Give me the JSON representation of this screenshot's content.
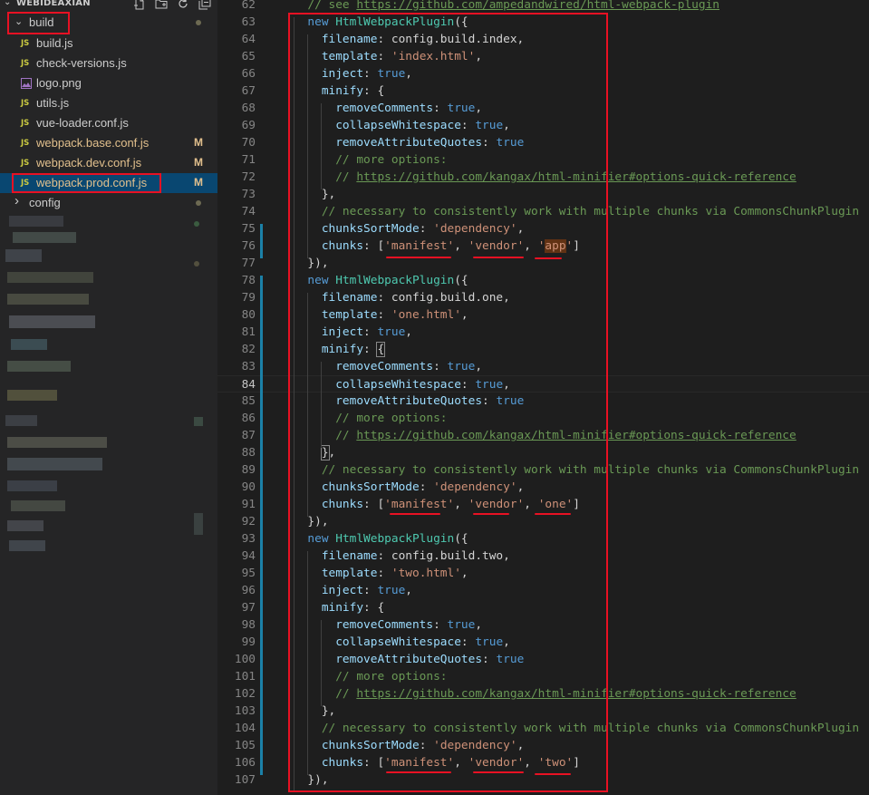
{
  "explorer": {
    "title": "WEBIDEAXIAN",
    "actions": [
      "new-file-icon",
      "new-folder-icon",
      "refresh-icon",
      "collapse-all-icon"
    ],
    "items": [
      {
        "label": "build",
        "kind": "folder-open",
        "status": "dot"
      },
      {
        "label": "build.js",
        "kind": "js",
        "status": ""
      },
      {
        "label": "check-versions.js",
        "kind": "js",
        "status": ""
      },
      {
        "label": "logo.png",
        "kind": "image",
        "status": ""
      },
      {
        "label": "utils.js",
        "kind": "js",
        "status": ""
      },
      {
        "label": "vue-loader.conf.js",
        "kind": "js",
        "status": ""
      },
      {
        "label": "webpack.base.conf.js",
        "kind": "js",
        "status": "M"
      },
      {
        "label": "webpack.dev.conf.js",
        "kind": "js",
        "status": "M"
      },
      {
        "label": "webpack.prod.conf.js",
        "kind": "js",
        "status": "M",
        "selected": true
      },
      {
        "label": "config",
        "kind": "folder-closed",
        "status": "dot"
      }
    ],
    "js_badge": "JS"
  },
  "editor": {
    "active_line": 84,
    "lines": [
      {
        "n": 62,
        "tokens": [
          [
            "c",
            "  // see "
          ],
          [
            "cu",
            "https://github.com/ampedandwired/html-webpack-plugin"
          ]
        ]
      },
      {
        "n": 63,
        "tokens": [
          [
            "k",
            "  new "
          ],
          [
            "cls",
            "HtmlWebpackPlugin"
          ],
          [
            "d",
            "({"
          ]
        ]
      },
      {
        "n": 64,
        "tokens": [
          [
            "p",
            "    filename"
          ],
          [
            "d",
            ": config.build.index,"
          ]
        ]
      },
      {
        "n": 65,
        "tokens": [
          [
            "p",
            "    template"
          ],
          [
            "d",
            ": "
          ],
          [
            "s",
            "'index.html'"
          ],
          [
            "d",
            ","
          ]
        ]
      },
      {
        "n": 66,
        "tokens": [
          [
            "p",
            "    inject"
          ],
          [
            "d",
            ": "
          ],
          [
            "k",
            "true"
          ],
          [
            "d",
            ","
          ]
        ]
      },
      {
        "n": 67,
        "tokens": [
          [
            "p",
            "    minify"
          ],
          [
            "d",
            ": {"
          ]
        ]
      },
      {
        "n": 68,
        "tokens": [
          [
            "p",
            "      removeComments"
          ],
          [
            "d",
            ": "
          ],
          [
            "k",
            "true"
          ],
          [
            "d",
            ","
          ]
        ]
      },
      {
        "n": 69,
        "tokens": [
          [
            "p",
            "      collapseWhitespace"
          ],
          [
            "d",
            ": "
          ],
          [
            "k",
            "true"
          ],
          [
            "d",
            ","
          ]
        ]
      },
      {
        "n": 70,
        "tokens": [
          [
            "p",
            "      removeAttributeQuotes"
          ],
          [
            "d",
            ": "
          ],
          [
            "k",
            "true"
          ]
        ]
      },
      {
        "n": 71,
        "tokens": [
          [
            "c",
            "      // more options:"
          ]
        ]
      },
      {
        "n": 72,
        "tokens": [
          [
            "c",
            "      // "
          ],
          [
            "cu",
            "https://github.com/kangax/html-minifier#options-quick-reference"
          ]
        ]
      },
      {
        "n": 73,
        "tokens": [
          [
            "d",
            "    },"
          ]
        ]
      },
      {
        "n": 74,
        "tokens": [
          [
            "c",
            "    // necessary to consistently work with multiple chunks via CommonsChunkPlugin"
          ]
        ]
      },
      {
        "n": 75,
        "tokens": [
          [
            "p",
            "    chunksSortMode"
          ],
          [
            "d",
            ": "
          ],
          [
            "s",
            "'dependency'"
          ],
          [
            "d",
            ","
          ]
        ]
      },
      {
        "n": 76,
        "tokens": [
          [
            "p",
            "    chunks"
          ],
          [
            "d",
            ": ["
          ],
          [
            "s",
            "'manifest'"
          ],
          [
            "d",
            ", "
          ],
          [
            "s",
            "'vendor'"
          ],
          [
            "d",
            ", "
          ],
          [
            "shl",
            "'app'"
          ],
          [
            "d",
            "]"
          ]
        ]
      },
      {
        "n": 77,
        "tokens": [
          [
            "d",
            "  }),"
          ]
        ]
      },
      {
        "n": 78,
        "tokens": [
          [
            "k",
            "  new "
          ],
          [
            "cls",
            "HtmlWebpackPlugin"
          ],
          [
            "d",
            "({"
          ]
        ]
      },
      {
        "n": 79,
        "tokens": [
          [
            "p",
            "    filename"
          ],
          [
            "d",
            ": config.build.one,"
          ]
        ]
      },
      {
        "n": 80,
        "tokens": [
          [
            "p",
            "    template"
          ],
          [
            "d",
            ": "
          ],
          [
            "s",
            "'one.html'"
          ],
          [
            "d",
            ","
          ]
        ]
      },
      {
        "n": 81,
        "tokens": [
          [
            "p",
            "    inject"
          ],
          [
            "d",
            ": "
          ],
          [
            "k",
            "true"
          ],
          [
            "d",
            ","
          ]
        ]
      },
      {
        "n": 82,
        "tokens": [
          [
            "p",
            "    minify"
          ],
          [
            "d",
            ": "
          ],
          [
            "dbr",
            "{"
          ]
        ]
      },
      {
        "n": 83,
        "tokens": [
          [
            "p",
            "      removeComments"
          ],
          [
            "d",
            ": "
          ],
          [
            "k",
            "true"
          ],
          [
            "d",
            ","
          ]
        ]
      },
      {
        "n": 84,
        "tokens": [
          [
            "p",
            "      collapseWhitespace"
          ],
          [
            "d",
            ": "
          ],
          [
            "k",
            "true"
          ],
          [
            "d",
            ","
          ]
        ]
      },
      {
        "n": 85,
        "tokens": [
          [
            "p",
            "      removeAttributeQuotes"
          ],
          [
            "d",
            ": "
          ],
          [
            "k",
            "true"
          ]
        ]
      },
      {
        "n": 86,
        "tokens": [
          [
            "c",
            "      // more options:"
          ]
        ]
      },
      {
        "n": 87,
        "tokens": [
          [
            "c",
            "      // "
          ],
          [
            "cu",
            "https://github.com/kangax/html-minifier#options-quick-reference"
          ]
        ]
      },
      {
        "n": 88,
        "tokens": [
          [
            "d",
            "    "
          ],
          [
            "dbr",
            "}"
          ],
          [
            "d",
            ","
          ]
        ]
      },
      {
        "n": 89,
        "tokens": [
          [
            "c",
            "    // necessary to consistently work with multiple chunks via CommonsChunkPlugin"
          ]
        ]
      },
      {
        "n": 90,
        "tokens": [
          [
            "p",
            "    chunksSortMode"
          ],
          [
            "d",
            ": "
          ],
          [
            "s",
            "'dependency'"
          ],
          [
            "d",
            ","
          ]
        ]
      },
      {
        "n": 91,
        "tokens": [
          [
            "p",
            "    chunks"
          ],
          [
            "d",
            ": ["
          ],
          [
            "s",
            "'manifest'"
          ],
          [
            "d",
            ", "
          ],
          [
            "s",
            "'vendor'"
          ],
          [
            "d",
            ", "
          ],
          [
            "s",
            "'one'"
          ],
          [
            "d",
            "]"
          ]
        ]
      },
      {
        "n": 92,
        "tokens": [
          [
            "d",
            "  }),"
          ]
        ]
      },
      {
        "n": 93,
        "tokens": [
          [
            "k",
            "  new "
          ],
          [
            "cls",
            "HtmlWebpackPlugin"
          ],
          [
            "d",
            "({"
          ]
        ]
      },
      {
        "n": 94,
        "tokens": [
          [
            "p",
            "    filename"
          ],
          [
            "d",
            ": config.build.two,"
          ]
        ]
      },
      {
        "n": 95,
        "tokens": [
          [
            "p",
            "    template"
          ],
          [
            "d",
            ": "
          ],
          [
            "s",
            "'two.html'"
          ],
          [
            "d",
            ","
          ]
        ]
      },
      {
        "n": 96,
        "tokens": [
          [
            "p",
            "    inject"
          ],
          [
            "d",
            ": "
          ],
          [
            "k",
            "true"
          ],
          [
            "d",
            ","
          ]
        ]
      },
      {
        "n": 97,
        "tokens": [
          [
            "p",
            "    minify"
          ],
          [
            "d",
            ": {"
          ]
        ]
      },
      {
        "n": 98,
        "tokens": [
          [
            "p",
            "      removeComments"
          ],
          [
            "d",
            ": "
          ],
          [
            "k",
            "true"
          ],
          [
            "d",
            ","
          ]
        ]
      },
      {
        "n": 99,
        "tokens": [
          [
            "p",
            "      collapseWhitespace"
          ],
          [
            "d",
            ": "
          ],
          [
            "k",
            "true"
          ],
          [
            "d",
            ","
          ]
        ]
      },
      {
        "n": 100,
        "tokens": [
          [
            "p",
            "      removeAttributeQuotes"
          ],
          [
            "d",
            ": "
          ],
          [
            "k",
            "true"
          ]
        ]
      },
      {
        "n": 101,
        "tokens": [
          [
            "c",
            "      // more options:"
          ]
        ]
      },
      {
        "n": 102,
        "tokens": [
          [
            "c",
            "      // "
          ],
          [
            "cu",
            "https://github.com/kangax/html-minifier#options-quick-reference"
          ]
        ]
      },
      {
        "n": 103,
        "tokens": [
          [
            "d",
            "    },"
          ]
        ]
      },
      {
        "n": 104,
        "tokens": [
          [
            "c",
            "    // necessary to consistently work with multiple chunks via CommonsChunkPlugin"
          ]
        ]
      },
      {
        "n": 105,
        "tokens": [
          [
            "p",
            "    chunksSortMode"
          ],
          [
            "d",
            ": "
          ],
          [
            "s",
            "'dependency'"
          ],
          [
            "d",
            ","
          ]
        ]
      },
      {
        "n": 106,
        "tokens": [
          [
            "p",
            "    chunks"
          ],
          [
            "d",
            ": ["
          ],
          [
            "s",
            "'manifest'"
          ],
          [
            "d",
            ", "
          ],
          [
            "s",
            "'vendor'"
          ],
          [
            "d",
            ", "
          ],
          [
            "s",
            "'two'"
          ],
          [
            "d",
            "]"
          ]
        ]
      },
      {
        "n": 107,
        "tokens": [
          [
            "d",
            "  }),"
          ]
        ]
      }
    ]
  },
  "colors": {
    "annotation_red": "#e81123",
    "modified": "#e2c08d",
    "selection": "#094771",
    "git_modified_bar": "#1b81a8"
  }
}
